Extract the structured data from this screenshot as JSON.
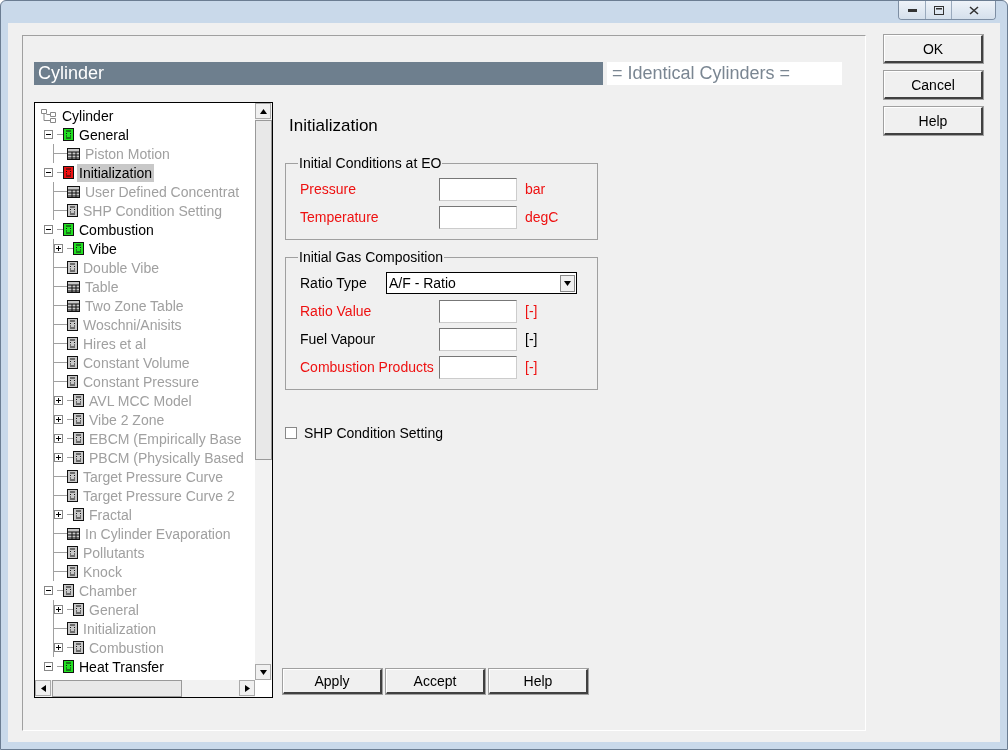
{
  "header": {
    "title": "Cylinder",
    "note": "= Identical Cylinders ="
  },
  "tree": {
    "root": "Cylinder",
    "items": [
      {
        "label": "General",
        "kind": "sheet",
        "color": "#22e022",
        "enabled": true,
        "selected": false,
        "expanded": true,
        "children": [
          {
            "label": "Piston Motion",
            "kind": "table",
            "color": "#c8c8c8",
            "enabled": false,
            "selected": false
          }
        ]
      },
      {
        "label": "Initialization",
        "kind": "sheet",
        "color": "#ee1111",
        "enabled": true,
        "selected": true,
        "expanded": true,
        "children": [
          {
            "label": "User Defined Concentrat",
            "kind": "table",
            "color": "#c8c8c8",
            "enabled": false,
            "selected": false
          },
          {
            "label": "SHP Condition Setting",
            "kind": "sheet",
            "color": "#c8c8c8",
            "enabled": false,
            "selected": false
          }
        ]
      },
      {
        "label": "Combustion",
        "kind": "sheet",
        "color": "#22e022",
        "enabled": true,
        "selected": false,
        "expanded": true,
        "children": [
          {
            "label": "Vibe",
            "kind": "sheet",
            "color": "#22e022",
            "enabled": true,
            "selected": false,
            "expanded": false
          },
          {
            "label": "Double Vibe",
            "kind": "sheet",
            "color": "#c8c8c8",
            "enabled": false,
            "selected": false
          },
          {
            "label": "Table",
            "kind": "table",
            "color": "#c8c8c8",
            "enabled": false,
            "selected": false
          },
          {
            "label": "Two Zone Table",
            "kind": "table",
            "color": "#c8c8c8",
            "enabled": false,
            "selected": false
          },
          {
            "label": "Woschni/Anisits",
            "kind": "sheet",
            "color": "#c8c8c8",
            "enabled": false,
            "selected": false
          },
          {
            "label": "Hires et al",
            "kind": "sheet",
            "color": "#c8c8c8",
            "enabled": false,
            "selected": false
          },
          {
            "label": "Constant Volume",
            "kind": "sheet",
            "color": "#c8c8c8",
            "enabled": false,
            "selected": false
          },
          {
            "label": "Constant Pressure",
            "kind": "sheet",
            "color": "#c8c8c8",
            "enabled": false,
            "selected": false
          },
          {
            "label": "AVL MCC Model",
            "kind": "sheet",
            "color": "#c8c8c8",
            "enabled": false,
            "selected": false,
            "expanded": false
          },
          {
            "label": "Vibe 2 Zone",
            "kind": "sheet",
            "color": "#c8c8c8",
            "enabled": false,
            "selected": false,
            "expanded": false
          },
          {
            "label": "EBCM (Empirically Base",
            "kind": "sheet",
            "color": "#c8c8c8",
            "enabled": false,
            "selected": false,
            "expanded": false
          },
          {
            "label": "PBCM (Physically Based",
            "kind": "sheet",
            "color": "#c8c8c8",
            "enabled": false,
            "selected": false,
            "expanded": false
          },
          {
            "label": "Target Pressure Curve",
            "kind": "sheet",
            "color": "#c8c8c8",
            "enabled": false,
            "selected": false
          },
          {
            "label": "Target Pressure Curve 2",
            "kind": "sheet",
            "color": "#c8c8c8",
            "enabled": false,
            "selected": false
          },
          {
            "label": "Fractal",
            "kind": "sheet",
            "color": "#c8c8c8",
            "enabled": false,
            "selected": false,
            "expanded": false
          },
          {
            "label": "In Cylinder Evaporation",
            "kind": "table",
            "color": "#c8c8c8",
            "enabled": false,
            "selected": false
          },
          {
            "label": "Pollutants",
            "kind": "sheet",
            "color": "#c8c8c8",
            "enabled": false,
            "selected": false
          },
          {
            "label": "Knock",
            "kind": "sheet",
            "color": "#c8c8c8",
            "enabled": false,
            "selected": false
          }
        ]
      },
      {
        "label": "Chamber",
        "kind": "sheet",
        "color": "#c8c8c8",
        "enabled": false,
        "selected": false,
        "expanded": true,
        "children": [
          {
            "label": "General",
            "kind": "sheet",
            "color": "#c8c8c8",
            "enabled": false,
            "selected": false,
            "expanded": false
          },
          {
            "label": "Initialization",
            "kind": "sheet",
            "color": "#c8c8c8",
            "enabled": false,
            "selected": false
          },
          {
            "label": "Combustion",
            "kind": "sheet",
            "color": "#c8c8c8",
            "enabled": false,
            "selected": false,
            "expanded": false
          }
        ]
      },
      {
        "label": "Heat Transfer",
        "kind": "sheet",
        "color": "#22e022",
        "enabled": true,
        "selected": false,
        "expanded": true
      }
    ]
  },
  "panel": {
    "title": "Initialization",
    "groups": [
      {
        "title": "Initial Conditions at EO",
        "fields": [
          {
            "kind": "input",
            "label": "Pressure",
            "required": true,
            "unit": "bar"
          },
          {
            "kind": "input",
            "label": "Temperature",
            "required": true,
            "unit": "degC"
          }
        ]
      },
      {
        "title": "Initial Gas Composition",
        "fields": [
          {
            "kind": "select",
            "label": "Ratio Type",
            "required": false,
            "value": "A/F - Ratio"
          },
          {
            "kind": "input",
            "label": "Ratio Value",
            "required": true,
            "unit": "[-]"
          },
          {
            "kind": "input",
            "label": "Fuel Vapour",
            "required": false,
            "unit": "[-]"
          },
          {
            "kind": "input",
            "label": "Combustion Products",
            "required": true,
            "unit": "[-]"
          }
        ]
      }
    ],
    "checkbox": {
      "label": "SHP Condition Setting",
      "checked": false
    },
    "buttons": [
      "Apply",
      "Accept",
      "Help"
    ]
  },
  "dialog_buttons": [
    "OK",
    "Cancel",
    "Help"
  ]
}
